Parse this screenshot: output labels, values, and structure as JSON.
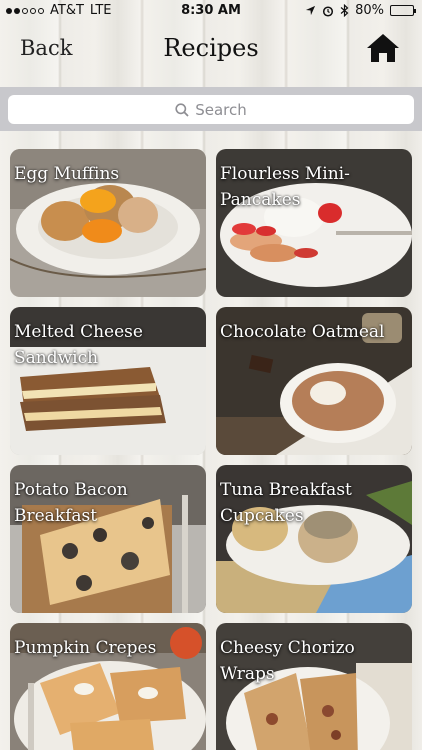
{
  "status_bar": {
    "carrier": "AT&T",
    "network": "LTE",
    "time": "8:30 AM",
    "battery": "80%",
    "battery_fraction": 0.8
  },
  "nav": {
    "back_label": "Back",
    "title": "Recipes",
    "home_icon": "home-icon"
  },
  "search": {
    "placeholder": "Search",
    "icon": "search-icon"
  },
  "recipes": [
    {
      "label": "Egg Muffins"
    },
    {
      "label": "Flourless Mini-Pancakes"
    },
    {
      "label": "Melted Cheese Sandwich"
    },
    {
      "label": "Chocolate Oatmeal"
    },
    {
      "label": "Potato Bacon Breakfast"
    },
    {
      "label": "Tuna Breakfast Cupcakes"
    },
    {
      "label": "Pumpkin Crepes"
    },
    {
      "label": "Cheesy Chorizo Wraps"
    }
  ]
}
